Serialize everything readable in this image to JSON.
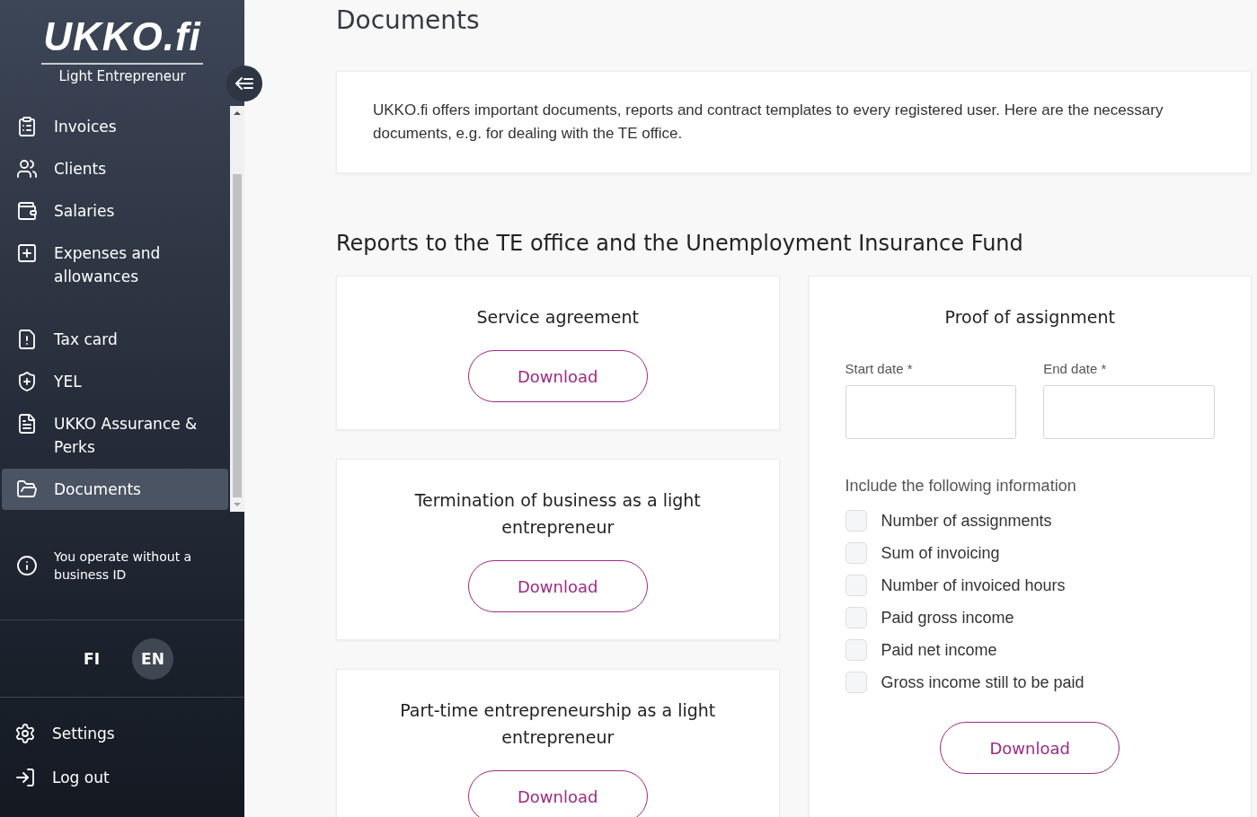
{
  "sidebar": {
    "logo": "UKKO.fi",
    "tagline": "Light Entrepreneur",
    "nav_items": [
      {
        "label": "Invoices",
        "selected": false
      },
      {
        "label": "Clients",
        "selected": false
      },
      {
        "label": "Salaries",
        "selected": false
      },
      {
        "label": "Expenses and allowances",
        "selected": false
      },
      {
        "label": "Tax card",
        "selected": false
      },
      {
        "label": "YEL",
        "selected": false
      },
      {
        "label": "UKKO Assurance & Perks",
        "selected": false
      },
      {
        "label": "Documents",
        "selected": true
      }
    ],
    "notice": "You operate without a business ID",
    "languages": [
      {
        "label": "FI",
        "selected": false
      },
      {
        "label": "EN",
        "selected": true
      }
    ],
    "bottom_items": [
      {
        "label": "Settings"
      },
      {
        "label": "Log out"
      }
    ]
  },
  "page_title": "Documents",
  "intro": "UKKO.fi offers important documents, reports and contract templates to every registered user. Here are the necessary documents, e.g. for dealing with the TE office.",
  "section_title": "Reports to the TE office and the Unemployment Insurance Fund",
  "document_cards": [
    {
      "title": "Service agreement",
      "button": "Download"
    },
    {
      "title": "Termination of business as a light entrepreneur",
      "button": "Download"
    },
    {
      "title": "Part-time entrepreneurship as a light entrepreneur",
      "button": "Download"
    }
  ],
  "proof_card": {
    "title": "Proof of assignment",
    "fields": [
      {
        "label": "Start date *"
      },
      {
        "label": "End date *"
      }
    ],
    "options_title": "Include the following information",
    "options": [
      {
        "label": "Number of assignments",
        "checked": false
      },
      {
        "label": "Sum of invoicing",
        "checked": false
      },
      {
        "label": "Number of invoiced hours",
        "checked": false
      },
      {
        "label": "Paid gross income",
        "checked": false
      },
      {
        "label": "Paid net income",
        "checked": false
      },
      {
        "label": "Gross income still to be paid",
        "checked": false
      }
    ],
    "button": "Download"
  }
}
